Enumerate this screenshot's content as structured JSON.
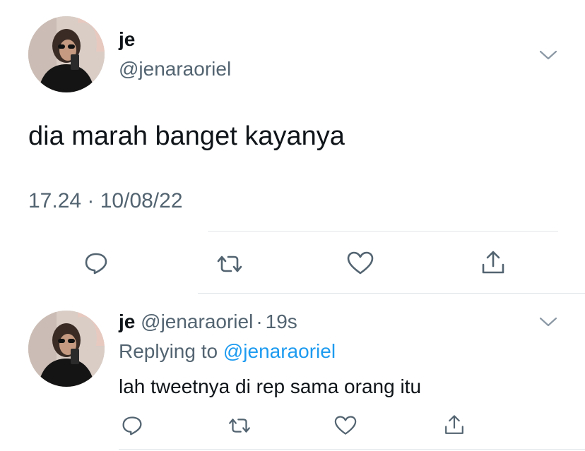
{
  "main_tweet": {
    "display_name": "je",
    "handle": "@jenaraoriel",
    "text": "dia marah banget kayanya",
    "timestamp": "17.24 · 10/08/22",
    "actions": [
      "reply-icon",
      "retweet-icon",
      "like-icon",
      "share-icon"
    ]
  },
  "reply_tweet": {
    "display_name": "je",
    "handle": "@jenaraoriel",
    "separator": "·",
    "age": "19s",
    "replying_label": "Replying to",
    "replying_handle": "@jenaraoriel",
    "text": "lah tweetnya di rep sama orang itu",
    "actions": [
      "reply-icon",
      "retweet-icon",
      "like-icon",
      "share-icon"
    ]
  },
  "colors": {
    "text": "#0f1419",
    "muted": "#536471",
    "link": "#1d9bf0",
    "divider": "#e1e5e8"
  }
}
